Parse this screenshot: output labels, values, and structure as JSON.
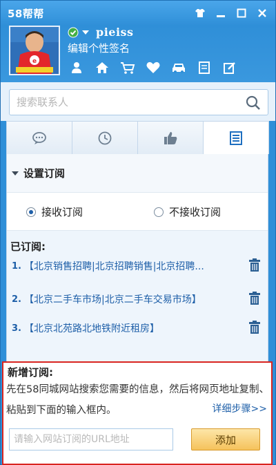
{
  "app": {
    "title": "58帮帮"
  },
  "user": {
    "name": "pieiss",
    "signature": "编辑个性签名"
  },
  "toolbar": {
    "icons": [
      "contact-icon",
      "home-icon",
      "cart-icon",
      "heart-icon",
      "car-icon",
      "notebook-icon",
      "edit-icon"
    ]
  },
  "search": {
    "placeholder": "搜索联系人"
  },
  "tabs": [
    {
      "icon": "chat-icon"
    },
    {
      "icon": "clock-icon"
    },
    {
      "icon": "thumbs-up-icon"
    },
    {
      "icon": "list-icon",
      "active": true
    }
  ],
  "settings": {
    "section_title": "设置订阅",
    "receive_label": "接收订阅",
    "no_receive_label": "不接收订阅",
    "receive_selected": true
  },
  "subscribed": {
    "title": "已订阅:",
    "items": [
      {
        "num": "1.",
        "text": "【北京销售招聘|北京招聘销售|北京招聘..."
      },
      {
        "num": "2.",
        "text": "【北京二手车市场|北京二手车交易市场】"
      },
      {
        "num": "3.",
        "text": "【北京北苑路北地铁附近租房】"
      }
    ]
  },
  "new_subscription": {
    "title": "新增订阅:",
    "description": "先在58同城网站搜索您需要的信息，然后将网页地址复制、粘贴到下面的输入框内。",
    "detail_link": "详细步骤>>",
    "url_placeholder": "请输入网站订阅的URL地址",
    "add_label": "添加"
  },
  "colors": {
    "brand_blue": "#2f8fd8",
    "link_blue": "#1e5fa8",
    "highlight_red": "#d9241f",
    "button_orange": "#f5c25b"
  }
}
